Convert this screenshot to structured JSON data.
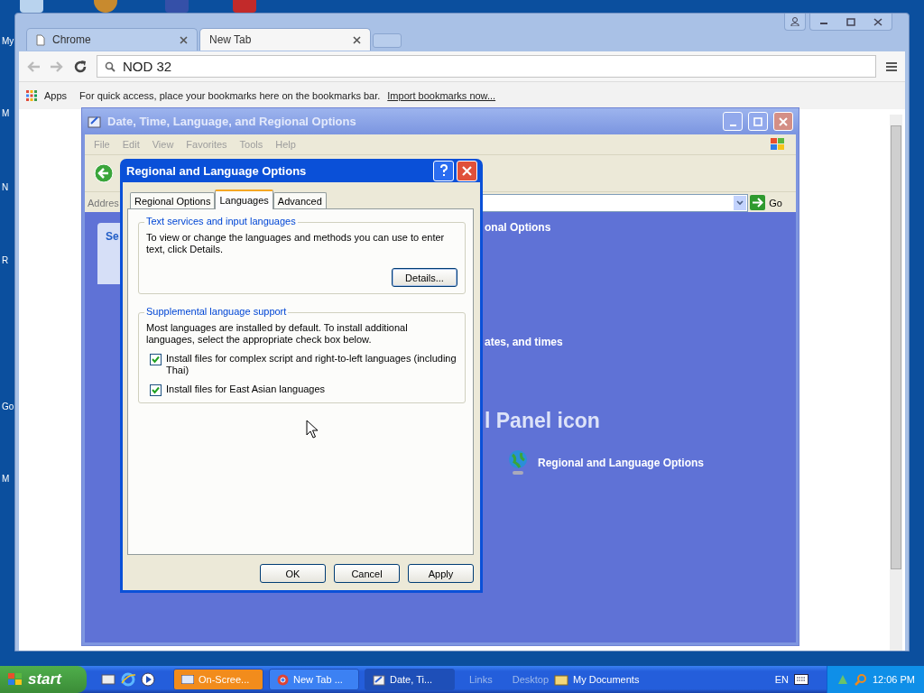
{
  "desktop_labels": [
    "My",
    "M",
    "N",
    "R",
    "Go",
    "M"
  ],
  "browser": {
    "tabs": [
      {
        "label": "Chrome",
        "selected": false
      },
      {
        "label": "New Tab",
        "selected": true
      }
    ],
    "omnibox": {
      "value": "NOD 32"
    },
    "bookmarks_bar": {
      "apps": "Apps",
      "hint": "For quick access, place your bookmarks here on the bookmarks bar.",
      "import_link": "Import bookmarks now..."
    }
  },
  "explorer": {
    "title": "Date, Time, Language, and Regional Options",
    "menu": [
      "File",
      "Edit",
      "View",
      "Favorites",
      "Tools",
      "Help"
    ],
    "address_label": "Addres",
    "go": "Go",
    "side_title": "Se",
    "texts": [
      {
        "kind": "heading",
        "text": "onal Options"
      },
      {
        "kind": "task",
        "text": "ates, and times"
      },
      {
        "kind": "big",
        "text": "l Panel icon"
      },
      {
        "kind": "link",
        "text": "Regional and Language Options"
      }
    ]
  },
  "dialog": {
    "title": "Regional and Language Options",
    "tabs": [
      {
        "label": "Regional Options",
        "selected": false
      },
      {
        "label": "Languages",
        "selected": true
      },
      {
        "label": "Advanced",
        "selected": false
      }
    ],
    "groups": [
      {
        "legend": "Text services and input languages",
        "text": "To view or change the languages and methods you can use to enter text, click Details.",
        "button": "Details..."
      },
      {
        "legend": "Supplemental language support",
        "text": "Most languages are installed by default. To install additional languages, select the appropriate check box below.",
        "checkboxes": [
          {
            "label": "Install files for complex script and right-to-left languages (including Thai)",
            "checked": true
          },
          {
            "label": "Install files for East Asian languages",
            "checked": true
          }
        ]
      }
    ],
    "buttons": [
      "OK",
      "Cancel",
      "Apply"
    ]
  },
  "taskbar": {
    "start": "start",
    "tasks": [
      {
        "label": "On-Scree...",
        "kind": "keyboard",
        "selected": false,
        "flashing": true
      },
      {
        "label": "New Tab ...",
        "kind": "browser",
        "selected": false,
        "flashing": false
      },
      {
        "label": "Date, Ti...",
        "kind": "folder",
        "selected": true,
        "flashing": false
      }
    ],
    "links": "Links",
    "desktop": "Desktop",
    "documents": "My Documents",
    "language": "EN",
    "clock": "12:06 PM"
  }
}
